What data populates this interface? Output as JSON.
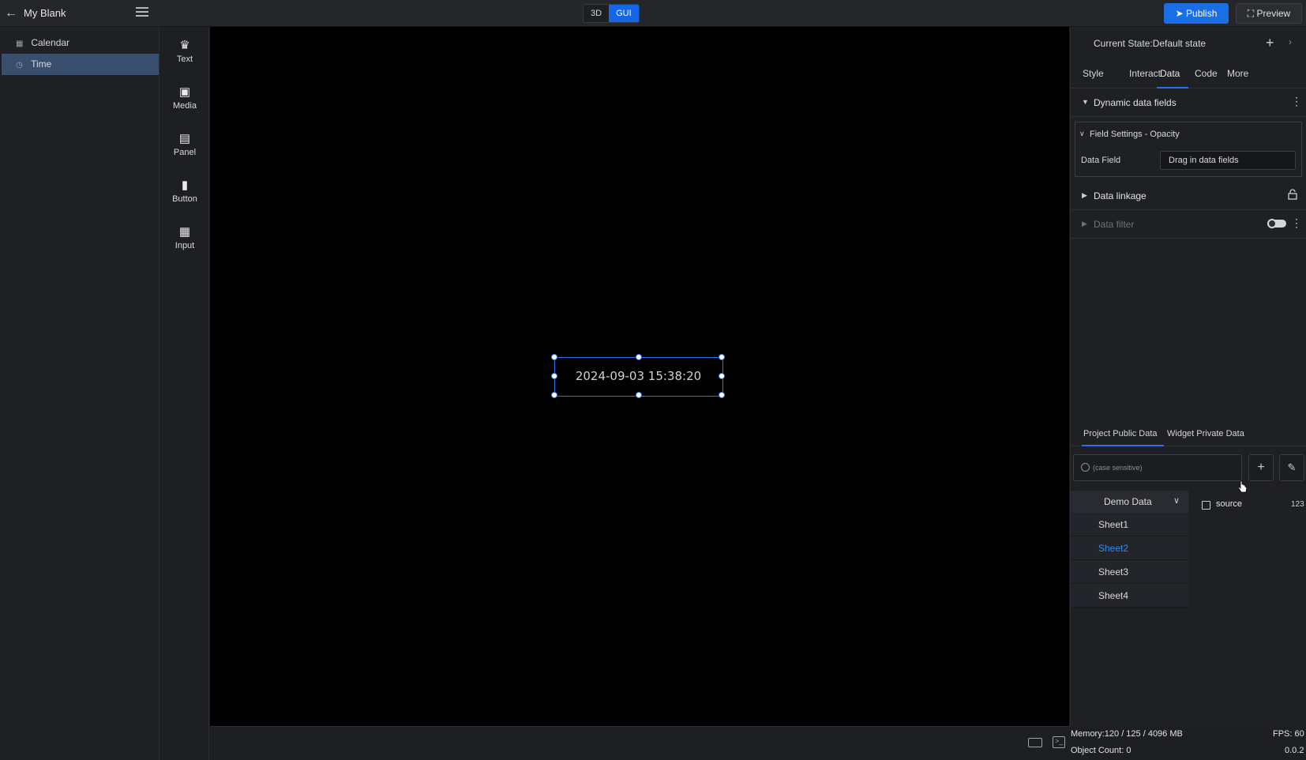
{
  "topbar": {
    "title": "My Blank",
    "mode_3d": "3D",
    "mode_gui": "GUI",
    "publish_label": "Publish",
    "preview_label": "Preview"
  },
  "layers": [
    {
      "label": "Calendar",
      "icon": "calendar-icon"
    },
    {
      "label": "Time",
      "icon": "clock-icon"
    }
  ],
  "widgets": [
    {
      "label": "Text",
      "icon": "crown-icon"
    },
    {
      "label": "Media",
      "icon": "camera-icon"
    },
    {
      "label": "Panel",
      "icon": "panel-icon"
    },
    {
      "label": "Button",
      "icon": "bars-icon"
    },
    {
      "label": "Input",
      "icon": "map-icon"
    }
  ],
  "canvas": {
    "selected_text": "2024-09-03 15:38:20"
  },
  "right": {
    "state_label": "Current State:Default state",
    "tabs": [
      "Style",
      "Interact",
      "Data",
      "Code",
      "More"
    ],
    "active_tab": "Data",
    "dynamic_fields_title": "Dynamic data fields",
    "field_settings_title": "Field Settings - Opacity",
    "data_field_label": "Data Field",
    "data_field_placeholder": "Drag in data fields",
    "data_linkage_title": "Data linkage",
    "data_filter_title": "Data filter"
  },
  "data_panel": {
    "tabs": [
      "Project Public Data",
      "Widget Private Data"
    ],
    "search_placeholder": "(case sensitive)",
    "source_name": "Demo Data",
    "sheets": [
      "Sheet1",
      "Sheet2",
      "Sheet3",
      "Sheet4"
    ],
    "active_sheet": "Sheet2",
    "field_name": "source",
    "field_type": "123"
  },
  "status": {
    "memory": "Memory:120 / 125 / 4096 MB",
    "fps": "FPS: 60",
    "object_count": "Object Count: 0",
    "version": "0.0.2"
  },
  "colors": {
    "accent": "#1b6fe6",
    "selection": "#2a6ff0",
    "active_sheet": "#2f8bf5"
  }
}
